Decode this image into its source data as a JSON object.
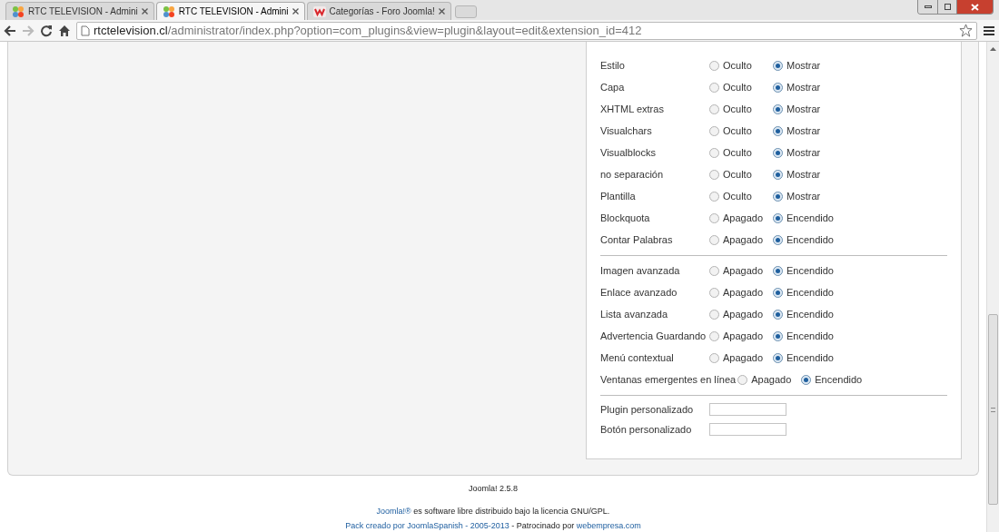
{
  "browser": {
    "tabs": [
      {
        "title": "RTC TELEVISION - Admini",
        "selected": false,
        "kind": "joomla"
      },
      {
        "title": "RTC TELEVISION - Admini",
        "selected": true,
        "kind": "joomla"
      },
      {
        "title": "Categorías - Foro Joomla!",
        "selected": false,
        "kind": "forum"
      }
    ],
    "url": {
      "host": "rtctelevision.cl",
      "path": "/administrator/index.php?option=com_plugins&view=plugin&layout=edit&extension_id=412"
    }
  },
  "sections": [
    {
      "rows": [
        {
          "kind": "radio",
          "label": "Estilo",
          "options": [
            {
              "label": "Oculto",
              "selected": false
            },
            {
              "label": "Mostrar",
              "selected": true
            }
          ]
        },
        {
          "kind": "radio",
          "label": "Capa",
          "options": [
            {
              "label": "Oculto",
              "selected": false
            },
            {
              "label": "Mostrar",
              "selected": true
            }
          ]
        },
        {
          "kind": "radio",
          "label": "XHTML extras",
          "options": [
            {
              "label": "Oculto",
              "selected": false
            },
            {
              "label": "Mostrar",
              "selected": true
            }
          ]
        },
        {
          "kind": "radio",
          "label": "Visualchars",
          "options": [
            {
              "label": "Oculto",
              "selected": false
            },
            {
              "label": "Mostrar",
              "selected": true
            }
          ]
        },
        {
          "kind": "radio",
          "label": "Visualblocks",
          "options": [
            {
              "label": "Oculto",
              "selected": false
            },
            {
              "label": "Mostrar",
              "selected": true
            }
          ]
        },
        {
          "kind": "radio",
          "label": "no separación",
          "options": [
            {
              "label": "Oculto",
              "selected": false
            },
            {
              "label": "Mostrar",
              "selected": true
            }
          ]
        },
        {
          "kind": "radio",
          "label": "Plantilla",
          "options": [
            {
              "label": "Oculto",
              "selected": false
            },
            {
              "label": "Mostrar",
              "selected": true
            }
          ]
        },
        {
          "kind": "radio",
          "label": "Blockquota",
          "options": [
            {
              "label": "Apagado",
              "selected": false
            },
            {
              "label": "Encendido",
              "selected": true
            }
          ]
        },
        {
          "kind": "radio",
          "label": "Contar Palabras",
          "options": [
            {
              "label": "Apagado",
              "selected": false
            },
            {
              "label": "Encendido",
              "selected": true
            }
          ]
        }
      ]
    },
    {
      "rows": [
        {
          "kind": "radio",
          "label": "Imagen avanzada",
          "options": [
            {
              "label": "Apagado",
              "selected": false
            },
            {
              "label": "Encendido",
              "selected": true
            }
          ]
        },
        {
          "kind": "radio",
          "label": "Enlace avanzado",
          "options": [
            {
              "label": "Apagado",
              "selected": false
            },
            {
              "label": "Encendido",
              "selected": true
            }
          ]
        },
        {
          "kind": "radio",
          "label": "Lista avanzada",
          "options": [
            {
              "label": "Apagado",
              "selected": false
            },
            {
              "label": "Encendido",
              "selected": true
            }
          ]
        },
        {
          "kind": "radio",
          "label": "Advertencia Guardando",
          "options": [
            {
              "label": "Apagado",
              "selected": false
            },
            {
              "label": "Encendido",
              "selected": true
            }
          ]
        },
        {
          "kind": "radio",
          "label": "Menú contextual",
          "options": [
            {
              "label": "Apagado",
              "selected": false
            },
            {
              "label": "Encendido",
              "selected": true
            }
          ]
        },
        {
          "kind": "radio",
          "label": "Ventanas emergentes en línea",
          "options": [
            {
              "label": "Apagado",
              "selected": false
            },
            {
              "label": "Encendido",
              "selected": true
            }
          ]
        }
      ]
    },
    {
      "rows": [
        {
          "kind": "text",
          "label": "Plugin personalizado"
        },
        {
          "kind": "text",
          "label": "Botón personalizado"
        }
      ]
    }
  ],
  "footer": {
    "version": "Joomla! 2.5.8",
    "lines": [
      [
        {
          "text": "Joomla!®",
          "link": true
        },
        {
          "text": "es software libre distribuido bajo la licencia GNU/GPL.",
          "link": false
        }
      ],
      [
        {
          "text": "Pack creado por JoomlaSpanish - 2005-2013",
          "link": true
        },
        {
          "text": "- Patrocinado por",
          "link": false
        },
        {
          "text": "webempresa.com",
          "link": true
        }
      ]
    ]
  }
}
